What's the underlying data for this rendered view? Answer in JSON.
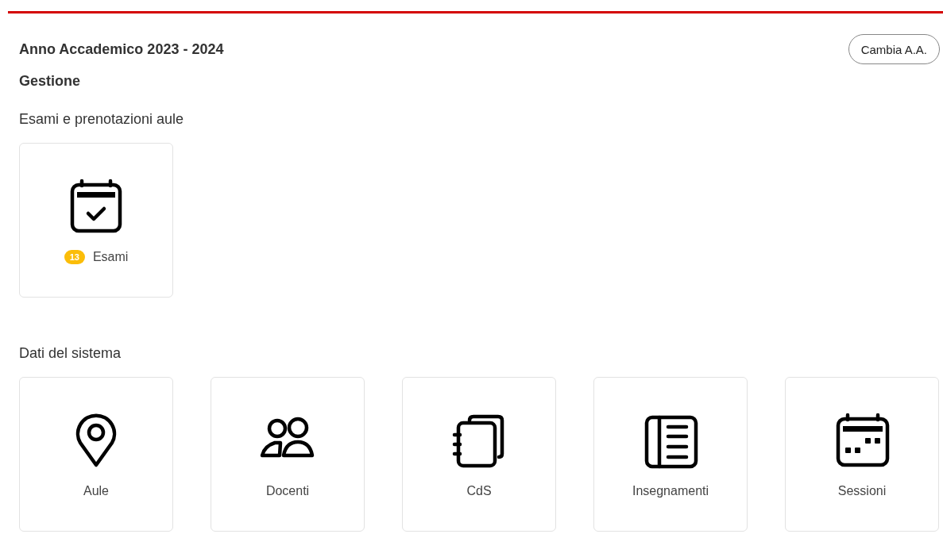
{
  "header": {
    "title": "Anno Accademico 2023 - 2024",
    "button": "Cambia A.A."
  },
  "subtitle": "Gestione",
  "sections": [
    {
      "title": "Esami e prenotazioni aule",
      "cards": [
        {
          "kind": "calendar-check",
          "label": "Esami",
          "badge": "13"
        }
      ]
    },
    {
      "title": "Dati del sistema",
      "cards": [
        {
          "kind": "pin",
          "label": "Aule"
        },
        {
          "kind": "people",
          "label": "Docenti"
        },
        {
          "kind": "notebooks",
          "label": "CdS"
        },
        {
          "kind": "book",
          "label": "Insegnamenti"
        },
        {
          "kind": "calendar-dots",
          "label": "Sessioni"
        }
      ]
    }
  ]
}
